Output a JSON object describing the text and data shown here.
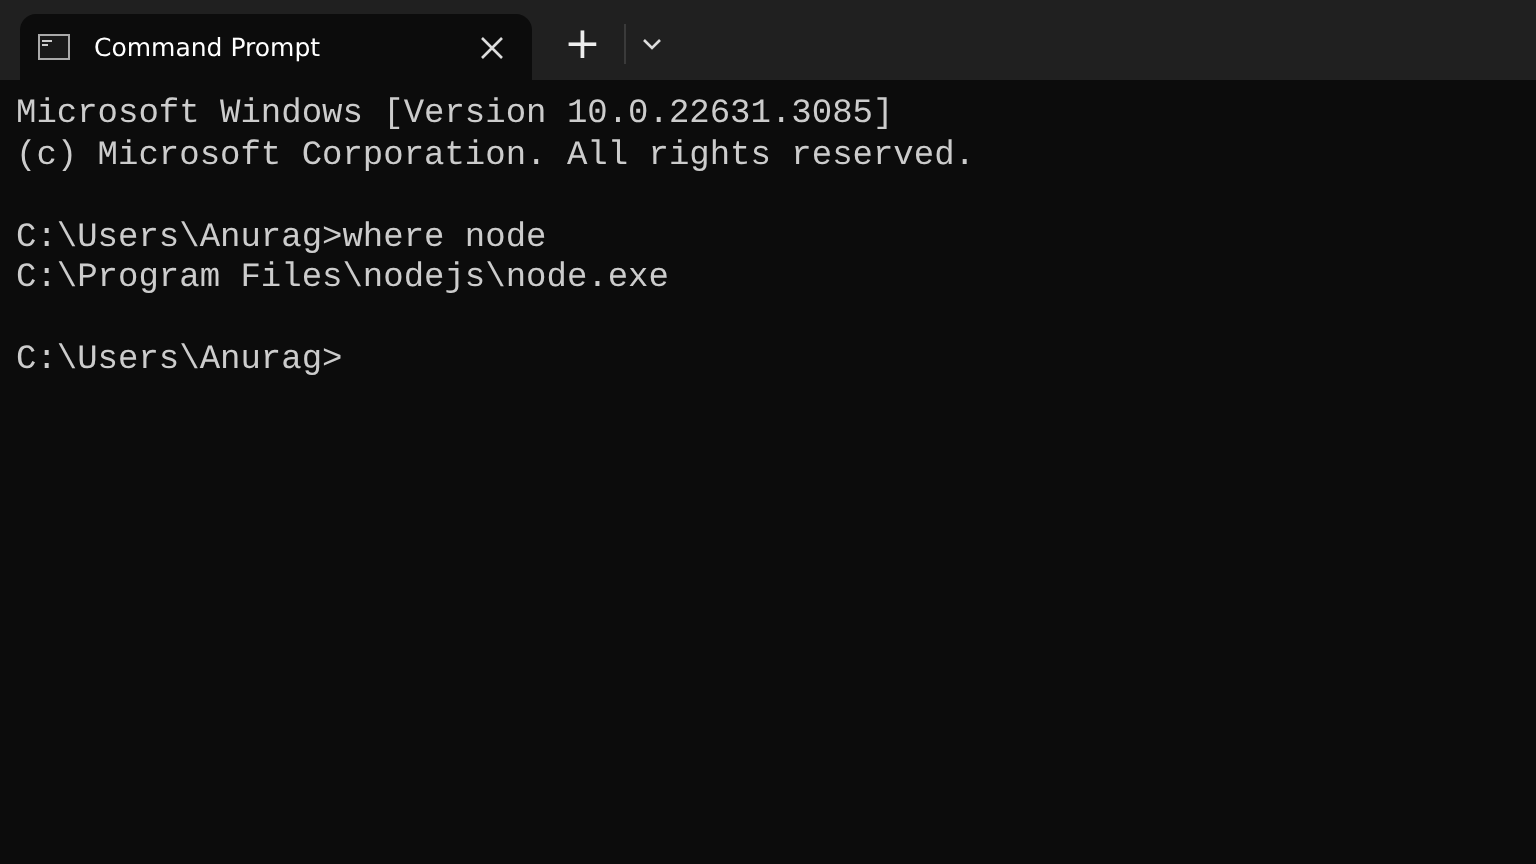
{
  "tabs": [
    {
      "title": "Command Prompt",
      "selected": true
    }
  ],
  "new_tab_button": "+",
  "output_blocks": [
    [
      "Microsoft Windows [Version 10.0.22631.3085]",
      "(c) Microsoft Corporation. All rights reserved."
    ],
    [
      "C:\\Users\\Anurag>where node",
      "C:\\Program Files\\nodejs\\node.exe"
    ],
    [
      "C:\\Users\\Anurag>"
    ]
  ]
}
